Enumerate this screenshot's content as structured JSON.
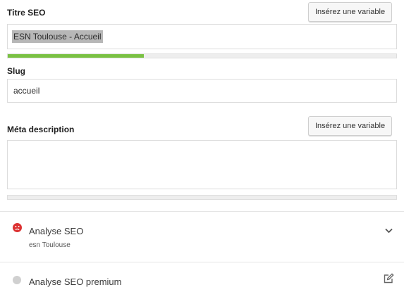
{
  "seo_title": {
    "label": "Titre SEO",
    "insert_variable_label": "Insérez une variable",
    "value": "ESN Toulouse - Accueil",
    "length_progress": 0.35,
    "progress_color": "#7ac143"
  },
  "slug": {
    "label": "Slug",
    "value": "accueil"
  },
  "meta_description": {
    "label": "Méta description",
    "insert_variable_label": "Insérez une variable",
    "value": "",
    "length_progress": 0.0
  },
  "seo_analysis": {
    "title": "Analyse SEO",
    "keyphrase": "esn Toulouse",
    "status_color": "#dc3232",
    "status_icon": "sad-face-icon",
    "toggle_icon": "chevron-down-icon"
  },
  "premium_analysis": {
    "title": "Analyse SEO premium",
    "status_color": "#d0d0d0",
    "action_icon": "edit-icon"
  }
}
